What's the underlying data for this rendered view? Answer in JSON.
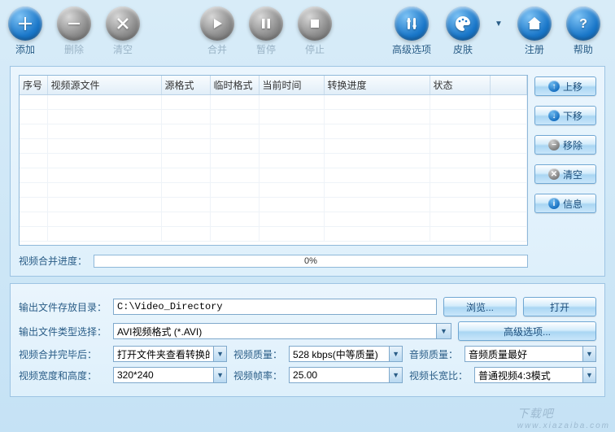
{
  "toolbar": {
    "add": "添加",
    "delete": "删除",
    "clear": "清空",
    "merge": "合并",
    "pause": "暂停",
    "stop": "停止",
    "advanced": "高级选项",
    "skin": "皮肤",
    "register": "注册",
    "help": "帮助"
  },
  "grid": {
    "headers": {
      "seq": "序号",
      "source": "视频源文件",
      "srcfmt": "源格式",
      "tmpfmt": "临时格式",
      "curtime": "当前时间",
      "progress": "转换进度",
      "status": "状态"
    },
    "rows": []
  },
  "sidebar": {
    "up": "上移",
    "down": "下移",
    "remove": "移除",
    "clear": "清空",
    "info": "信息"
  },
  "mergeProgress": {
    "label": "视频合并进度：",
    "text": "0%"
  },
  "form": {
    "outDirLabel": "输出文件存放目录：",
    "outDirValue": "C:\\Video_Directory",
    "browse": "浏览...",
    "open": "打开",
    "outTypeLabel": "输出文件类型选择：",
    "outTypeValue": "AVI视频格式 (*.AVI)",
    "advancedBtn": "高级选项...",
    "afterMergeLabel": "视频合并完毕后：",
    "afterMergeValue": "打开文件夹查看转换的",
    "vqualityLabel": "视频质量：",
    "vqualityValue": "528 kbps(中等质量)",
    "aqualityLabel": "音频质量：",
    "aqualityValue": "音频质量最好",
    "sizeLabel": "视频宽度和高度：",
    "sizeValue": "320*240",
    "fpsLabel": "视频帧率：",
    "fpsValue": "25.00",
    "aspectLabel": "视频长宽比：",
    "aspectValue": "普通视频4:3模式"
  },
  "watermark": {
    "main": "下载吧",
    "sub": "www.xiazaiba.com"
  }
}
